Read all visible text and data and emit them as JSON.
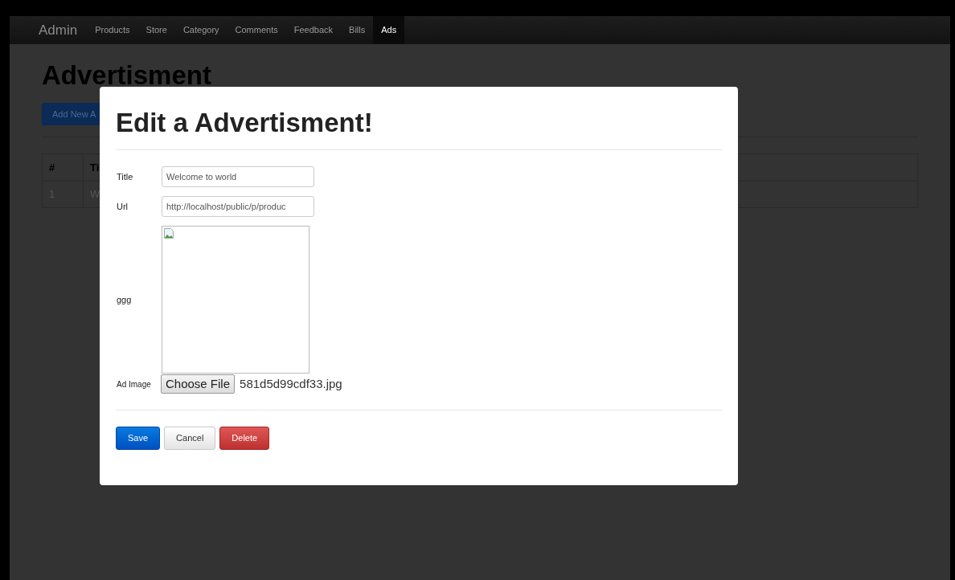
{
  "navbar": {
    "brand": "Admin",
    "items": [
      {
        "label": "Products",
        "selected": false
      },
      {
        "label": "Store",
        "selected": false
      },
      {
        "label": "Category",
        "selected": false
      },
      {
        "label": "Comments",
        "selected": false
      },
      {
        "label": "Feedback",
        "selected": false
      },
      {
        "label": "Bills",
        "selected": false
      },
      {
        "label": "Ads",
        "selected": true
      }
    ]
  },
  "page": {
    "heading": "Advertisment",
    "add_button": "Add New A",
    "table": {
      "columns": [
        "#",
        "Ti"
      ],
      "rows": [
        [
          "1",
          "W"
        ]
      ]
    }
  },
  "modal": {
    "title": "Edit a Advertisment!",
    "fields": [
      {
        "kind": "text",
        "label": "Title",
        "value": "Welcome to world"
      },
      {
        "kind": "text",
        "label": "Url",
        "value": "http://localhost/public/p/produc"
      },
      {
        "kind": "image",
        "label": "ggg"
      },
      {
        "kind": "file",
        "label": "Ad Image",
        "button": "Choose File",
        "filename": "581d5d99cdf33.jpg"
      }
    ],
    "buttons": [
      {
        "label": "Save",
        "kind": "primary"
      },
      {
        "label": "Cancel",
        "kind": "default"
      },
      {
        "label": "Delete",
        "kind": "danger"
      }
    ]
  }
}
